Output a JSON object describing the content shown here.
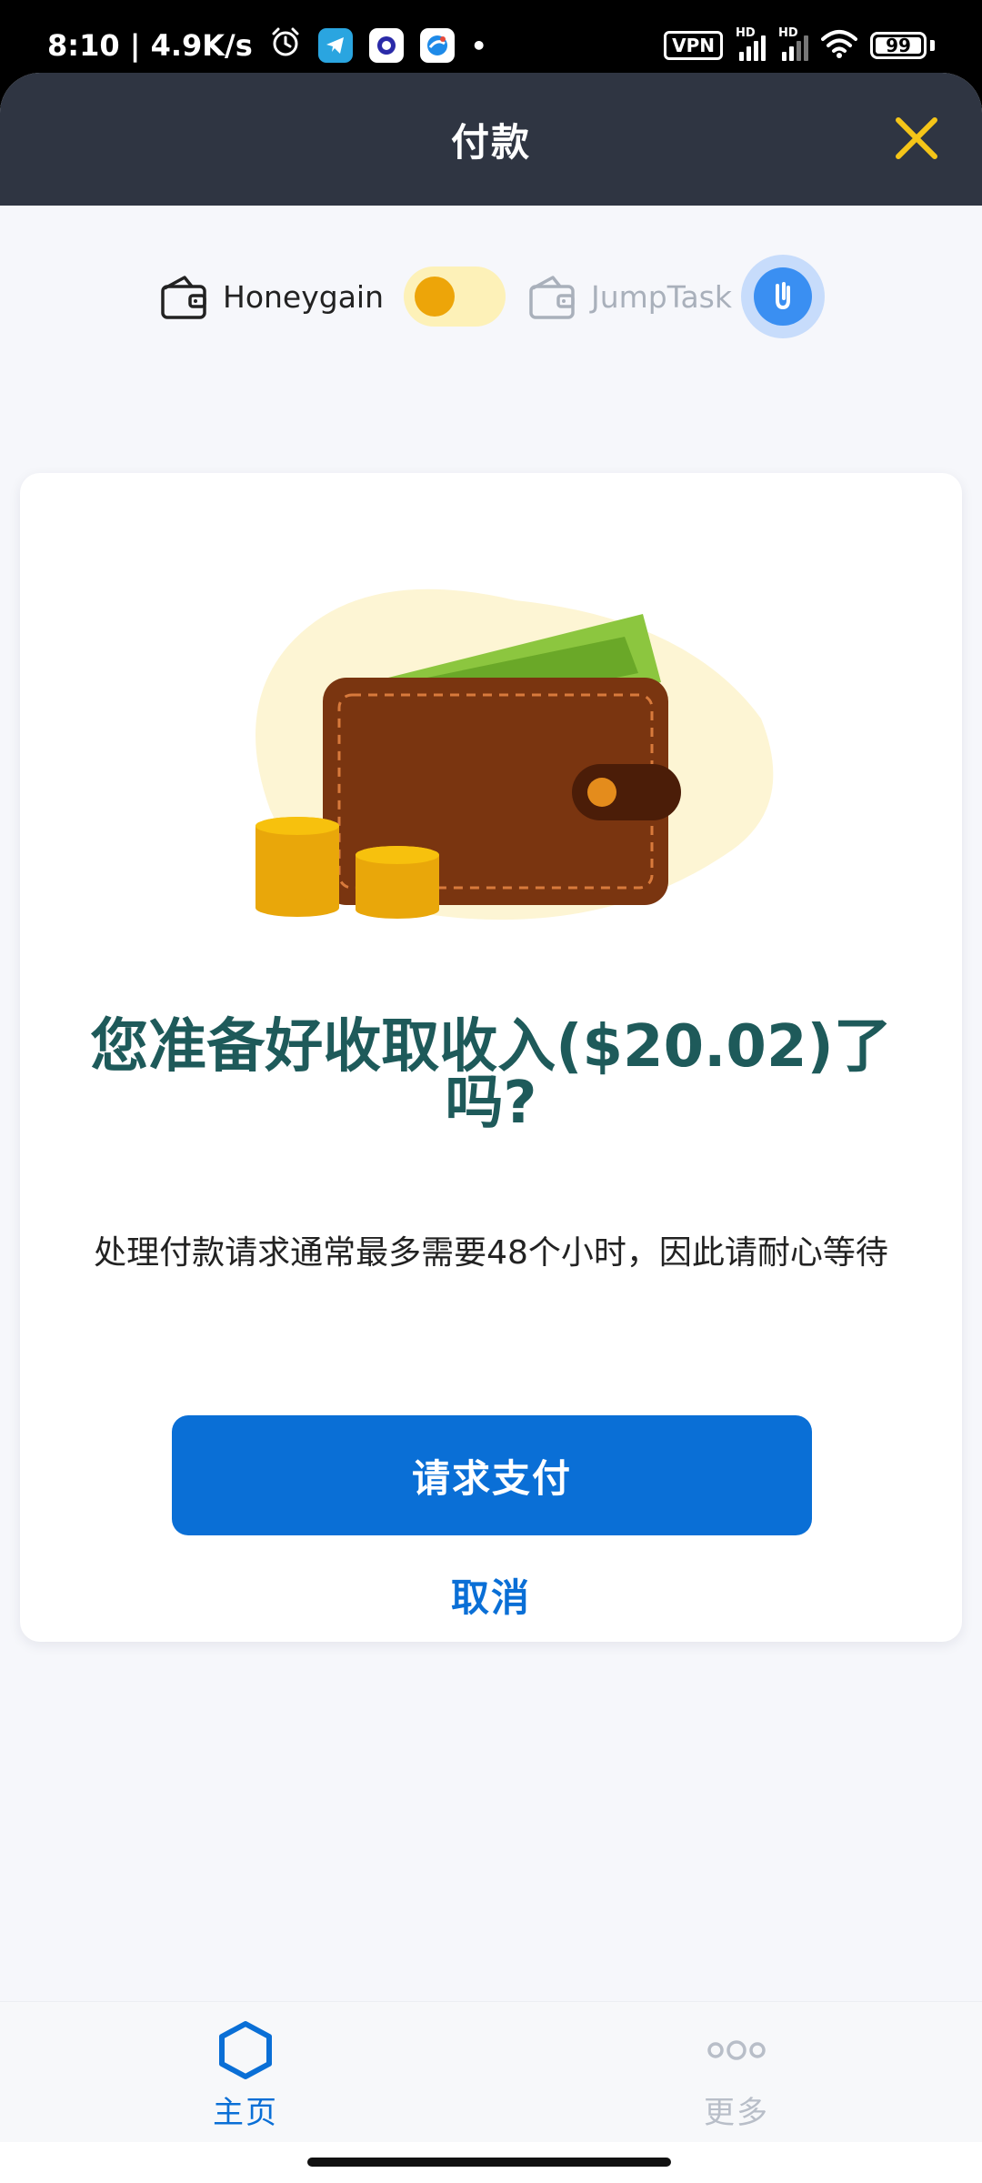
{
  "status_bar": {
    "time_speed": "8:10 | 4.9K/s",
    "vpn": "VPN",
    "hd1": "HD",
    "hd2": "HD",
    "battery": "99"
  },
  "header": {
    "title": "付款",
    "close_icon": "close-icon",
    "close_color": "#f5c518"
  },
  "toggle": {
    "left_label": "Honeygain",
    "right_label": "JumpTask",
    "selected": "Honeygain"
  },
  "card": {
    "headline": "您准备好收取收入($20.02)了吗?",
    "subtext": "处理付款请求通常最多需要48个小时，因此请耐心等待",
    "primary_button": "请求支付",
    "cancel_button": "取消"
  },
  "bottom_nav": {
    "items": [
      {
        "label": "主页",
        "icon": "hexagon-icon",
        "active": true
      },
      {
        "label": "更多",
        "icon": "more-dots-icon",
        "active": false
      }
    ]
  },
  "colors": {
    "accent": "#0a6fd6",
    "header_bg": "#2f3542",
    "headline": "#1e5a5a",
    "toggle_knob": "#eda509"
  }
}
